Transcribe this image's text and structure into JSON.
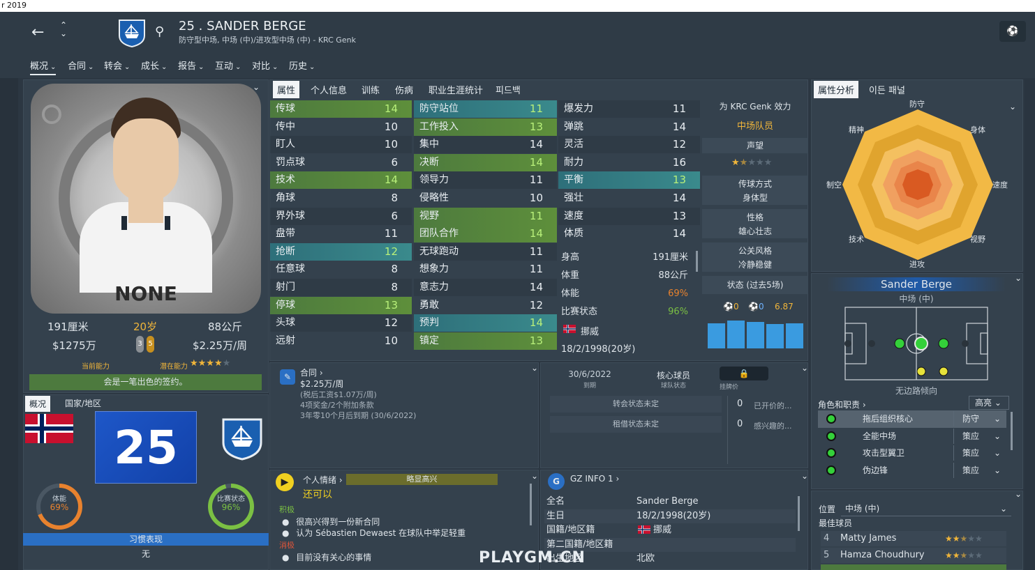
{
  "os_title": "r 2019",
  "header": {
    "player_name": "25 . SANDER BERGE",
    "subtitle": "防守型中场, 中场 (中)/进攻型中场 (中) - KRC Genk"
  },
  "menu": [
    "概况",
    "合同",
    "转会",
    "成长",
    "报告",
    "互动",
    "对比",
    "历史"
  ],
  "attr_tabs": [
    "属性",
    "个人信息",
    "训练",
    "伤病",
    "职业生涯统计",
    "피드백"
  ],
  "player_card": {
    "card_text": "NONE",
    "height": "191厘米",
    "age": "20岁",
    "weight": "88公斤",
    "value": "$1275万",
    "wage": "$2.25万/周",
    "ca_label": "当前能力",
    "pa_label": "潜在能力",
    "ca_badge1": "3",
    "ca_badge2": "5",
    "signing_note": "会是一笔出色的签约。"
  },
  "lower_tabs": [
    "概况",
    "国家/地区"
  ],
  "shirt_number": "25",
  "gauges": {
    "fitness_label": "体能",
    "fitness_value": "69%",
    "form_label": "比赛状态",
    "form_value": "96%"
  },
  "habit": {
    "title": "习惯表现",
    "value": "无"
  },
  "technical": [
    {
      "name": "传球",
      "value": "14",
      "hl": "green"
    },
    {
      "name": "传中",
      "value": "10",
      "hl": ""
    },
    {
      "name": "盯人",
      "value": "10",
      "hl": ""
    },
    {
      "name": "罚点球",
      "value": "6",
      "hl": ""
    },
    {
      "name": "技术",
      "value": "14",
      "hl": "green"
    },
    {
      "name": "角球",
      "value": "8",
      "hl": ""
    },
    {
      "name": "界外球",
      "value": "6",
      "hl": ""
    },
    {
      "name": "盘带",
      "value": "11",
      "hl": ""
    },
    {
      "name": "抢断",
      "value": "12",
      "hl": "teal"
    },
    {
      "name": "任意球",
      "value": "8",
      "hl": ""
    },
    {
      "name": "射门",
      "value": "8",
      "hl": ""
    },
    {
      "name": "停球",
      "value": "13",
      "hl": "green"
    },
    {
      "name": "头球",
      "value": "12",
      "hl": ""
    },
    {
      "name": "远射",
      "value": "10",
      "hl": ""
    }
  ],
  "mental": [
    {
      "name": "防守站位",
      "value": "11",
      "hl": "teal"
    },
    {
      "name": "工作投入",
      "value": "13",
      "hl": "green"
    },
    {
      "name": "集中",
      "value": "14",
      "hl": ""
    },
    {
      "name": "决断",
      "value": "14",
      "hl": "green"
    },
    {
      "name": "领导力",
      "value": "11",
      "hl": ""
    },
    {
      "name": "侵略性",
      "value": "10",
      "hl": ""
    },
    {
      "name": "视野",
      "value": "11",
      "hl": "green"
    },
    {
      "name": "团队合作",
      "value": "14",
      "hl": "green"
    },
    {
      "name": "无球跑动",
      "value": "11",
      "hl": ""
    },
    {
      "name": "想象力",
      "value": "11",
      "hl": ""
    },
    {
      "name": "意志力",
      "value": "14",
      "hl": ""
    },
    {
      "name": "勇敢",
      "value": "12",
      "hl": ""
    },
    {
      "name": "预判",
      "value": "14",
      "hl": "teal"
    },
    {
      "name": "镇定",
      "value": "13",
      "hl": "green"
    }
  ],
  "physical": [
    {
      "name": "爆发力",
      "value": "11",
      "hl": ""
    },
    {
      "name": "弹跳",
      "value": "14",
      "hl": ""
    },
    {
      "name": "灵活",
      "value": "12",
      "hl": ""
    },
    {
      "name": "耐力",
      "value": "16",
      "hl": ""
    },
    {
      "name": "平衡",
      "value": "13",
      "hl": "teal"
    },
    {
      "name": "强壮",
      "value": "14",
      "hl": ""
    },
    {
      "name": "速度",
      "value": "13",
      "hl": ""
    },
    {
      "name": "体质",
      "value": "14",
      "hl": ""
    }
  ],
  "body_info": [
    {
      "label": "身高",
      "value": "191厘米",
      "color": ""
    },
    {
      "label": "体重",
      "value": "88公斤",
      "color": ""
    },
    {
      "label": "体能",
      "value": "69%",
      "color": "#e8822e"
    },
    {
      "label": "比赛状态",
      "value": "96%",
      "color": "#7bc043"
    }
  ],
  "nationality": "挪威",
  "birth": "18/2/1998(20岁)",
  "club_info": {
    "plays_for": "为 KRC Genk 效力",
    "role": "中场队员",
    "reputation_label": "声望",
    "pref_foot_label": "传球方式",
    "pref_foot_value": "身体型",
    "personality_label": "性格",
    "personality_value": "雄心壮志",
    "media_label": "公关风格",
    "media_value": "冷静稳健",
    "form_label": "状态 (过去5场)",
    "goals": "0",
    "assists": "0",
    "rating": "6.87"
  },
  "contract": {
    "title": "合同",
    "wage": "$2.25万/周",
    "line1": "(税后工资$1.07万/周)",
    "line2": "4项奖金/2个附加条款",
    "line3": "3年零10个月后到期 (30/6/2022)"
  },
  "transfer": {
    "expiry": "30/6/2022",
    "expiry_label": "到期",
    "status": "核心球员",
    "status_label": "球队状态",
    "lock_label": "挂牌价",
    "transfer_status": "转会状态未定",
    "loan_status": "租借状态未定",
    "offers_count": "0",
    "offers_label": "已开价的...",
    "interest_count": "0",
    "interest_label": "感兴趣的..."
  },
  "happiness": {
    "title": "个人情绪",
    "bar_label": "略显高兴",
    "mood": "还可以",
    "positive_label": "积极",
    "positive": [
      "很高兴得到一份新合同",
      "认为 Sébastien Dewaest 在球队中举足轻重"
    ],
    "negative_label": "消极",
    "negative": [
      "目前没有关心的事情"
    ]
  },
  "gz_info": {
    "title": "GZ INFO 1",
    "rows": [
      {
        "label": "全名",
        "value": "Sander Berge"
      },
      {
        "label": "生日",
        "value": "18/2/1998(20岁)"
      },
      {
        "label": "国籍/地区籍",
        "value": "挪威"
      },
      {
        "label": "第二国籍/地区籍",
        "value": ""
      },
      {
        "label": "出生地区",
        "value": "北欧"
      }
    ]
  },
  "watermark": "PLAYGM.CN",
  "radar": {
    "tabs": [
      "属性分析",
      "이든 패널"
    ],
    "labels": [
      "防守",
      "身体",
      "速度",
      "视野",
      "进攻",
      "技术",
      "制空",
      "精神"
    ]
  },
  "position_panel": {
    "name": "Sander Berge",
    "position": "中场 (中)",
    "tendency": "无边路倾向",
    "roles_title": "角色和职责",
    "highlight": "高亮",
    "roles": [
      {
        "name": "拖后组织核心",
        "duty": "防守"
      },
      {
        "name": "全能中场",
        "duty": "策应"
      },
      {
        "name": "攻击型翼卫",
        "duty": "策应"
      },
      {
        "name": "伪边锋",
        "duty": "策应"
      }
    ]
  },
  "best_players": {
    "pos_label": "位置",
    "pos_value": "中场 (中)",
    "title": "最佳球员",
    "rows": [
      {
        "num": "4",
        "name": "Matty James",
        "stars": 2.5
      },
      {
        "num": "5",
        "name": "Hamza Choudhury",
        "stars": 2.5
      }
    ]
  }
}
